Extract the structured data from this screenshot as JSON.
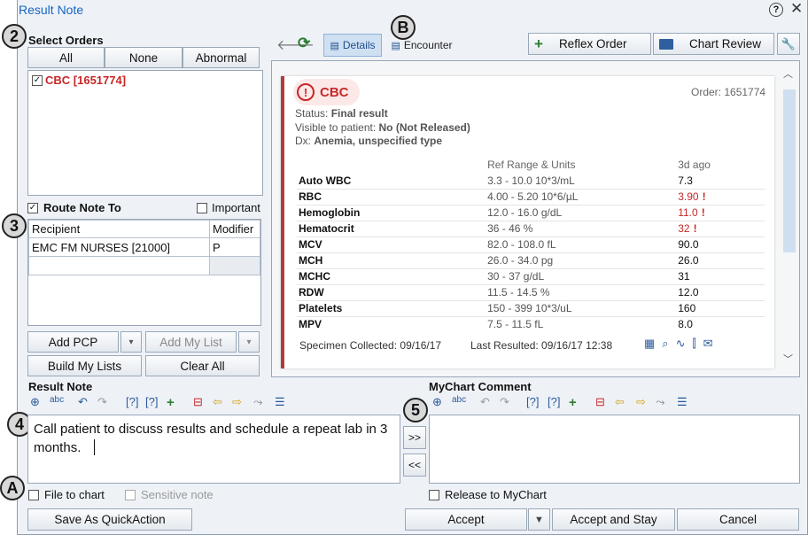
{
  "window": {
    "title": "Result Note"
  },
  "badges": {
    "b2": "2",
    "b3": "3",
    "b4": "4",
    "b5": "5",
    "bA": "A",
    "bB": "B"
  },
  "select_orders": {
    "heading": "Select Orders",
    "buttons": {
      "all": "All",
      "none": "None",
      "abnormal": "Abnormal"
    },
    "orders": [
      {
        "label": "CBC [1651774]",
        "checked": true
      }
    ]
  },
  "route": {
    "label": "Route Note To",
    "checked": true,
    "important_label": "Important",
    "important_checked": false,
    "columns": [
      "Recipient",
      "Modifier"
    ],
    "rows": [
      {
        "recipient": "EMC FM NURSES [21000]",
        "modifier": "P"
      },
      {
        "recipient": "",
        "modifier": ""
      }
    ]
  },
  "route_buttons": {
    "add_pcp": "Add PCP",
    "add_my_list": "Add My List",
    "build_my_lists": "Build My Lists",
    "clear_all": "Clear All"
  },
  "toolbar": {
    "details": "Details",
    "encounter": "Encounter",
    "reflex_order": "Reflex Order",
    "chart_review": "Chart Review"
  },
  "result": {
    "name": "CBC",
    "order": "Order: 1651774",
    "status_label": "Status:",
    "status_value": "Final result",
    "visible_label": "Visible to patient:",
    "visible_value": "No (Not Released)",
    "dx_label": "Dx:",
    "dx_value": "Anemia, unspecified type",
    "col_ref": "Ref Range & Units",
    "col_val": "3d ago",
    "rows": [
      {
        "name": "Auto WBC",
        "ref": "3.3 - 10.0 10*3/mL",
        "val": "7.3",
        "abnormal": false
      },
      {
        "name": "RBC",
        "ref": "4.00 - 5.20 10*6/µL",
        "val": "3.90",
        "abnormal": true
      },
      {
        "name": "Hemoglobin",
        "ref": "12.0 - 16.0 g/dL",
        "val": "11.0",
        "abnormal": true
      },
      {
        "name": "Hematocrit",
        "ref": "36 - 46 %",
        "val": "32",
        "abnormal": true
      },
      {
        "name": "MCV",
        "ref": "82.0 - 108.0 fL",
        "val": "90.0",
        "abnormal": false
      },
      {
        "name": "MCH",
        "ref": "26.0 - 34.0 pg",
        "val": "26.0",
        "abnormal": false
      },
      {
        "name": "MCHC",
        "ref": "30 - 37 g/dL",
        "val": "31",
        "abnormal": false
      },
      {
        "name": "RDW",
        "ref": "11.5 - 14.5 %",
        "val": "12.0",
        "abnormal": false
      },
      {
        "name": "Platelets",
        "ref": "150 - 399 10*3/uL",
        "val": "160",
        "abnormal": false
      },
      {
        "name": "MPV",
        "ref": "7.5 - 11.5 fL",
        "val": "8.0",
        "abnormal": false
      }
    ],
    "specimen": "Specimen Collected: 09/16/17",
    "last_resulted": "Last Resulted: 09/16/17 12:38"
  },
  "result_note": {
    "heading": "Result Note",
    "text": "Call patient to discuss results and schedule a repeat lab in 3 months."
  },
  "mychart": {
    "heading": "MyChart Comment",
    "text": ""
  },
  "transfer": {
    "right": ">>",
    "left": "<<"
  },
  "bottom": {
    "file_to_chart": "File to chart",
    "sensitive_note": "Sensitive note",
    "release_to_mychart": "Release to MyChart",
    "save_quickaction": "Save As QuickAction",
    "accept": "Accept",
    "accept_and_stay": "Accept and Stay",
    "cancel": "Cancel"
  }
}
